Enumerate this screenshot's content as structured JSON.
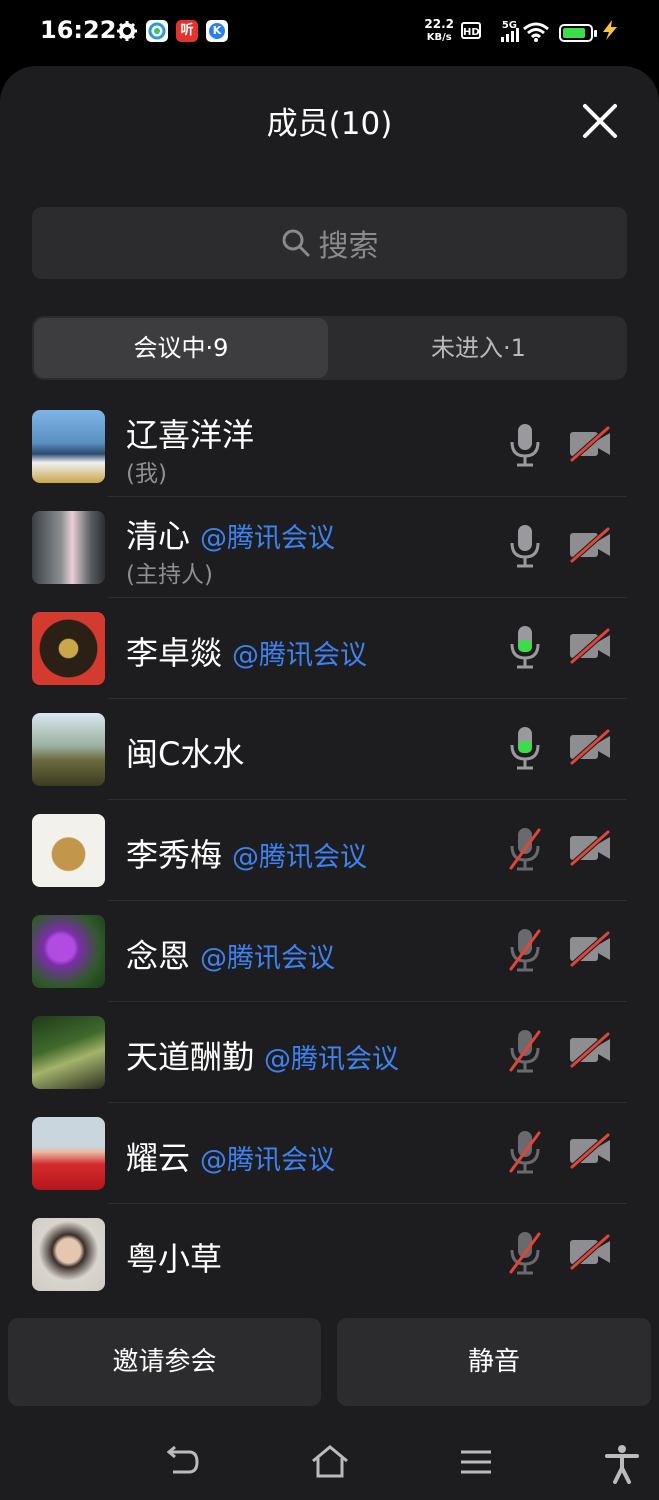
{
  "status_bar": {
    "time": "16:22",
    "speed_value": "22.2",
    "speed_unit": "KB/s",
    "hd": "HD",
    "network": "5G",
    "battery_level": 0.85,
    "app_icons": [
      "gear-icon",
      "browser-icon",
      "listen-app-icon",
      "k-app-icon"
    ],
    "listen_glyph": "听",
    "k_glyph": "K"
  },
  "sheet": {
    "title": "成员(10)",
    "search_placeholder": "搜索",
    "tabs": [
      {
        "label": "会议中·9",
        "active": true
      },
      {
        "label": "未进入·1",
        "active": false
      }
    ]
  },
  "members": [
    {
      "name": "辽喜洋洋",
      "tag": "",
      "role": "(我)",
      "mic": "on",
      "camera": "off"
    },
    {
      "name": "清心",
      "tag": "@腾讯会议",
      "role": "(主持人)",
      "mic": "on",
      "camera": "off"
    },
    {
      "name": "李卓燚",
      "tag": "@腾讯会议",
      "role": "",
      "mic": "speaking",
      "camera": "off"
    },
    {
      "name": "闽C水水",
      "tag": "",
      "role": "",
      "mic": "speaking",
      "camera": "off"
    },
    {
      "name": "李秀梅",
      "tag": "@腾讯会议",
      "role": "",
      "mic": "muted",
      "camera": "off"
    },
    {
      "name": "念恩",
      "tag": "@腾讯会议",
      "role": "",
      "mic": "muted",
      "camera": "off"
    },
    {
      "name": "天道酬勤",
      "tag": "@腾讯会议",
      "role": "",
      "mic": "muted",
      "camera": "off"
    },
    {
      "name": "耀云",
      "tag": "@腾讯会议",
      "role": "",
      "mic": "muted",
      "camera": "off"
    },
    {
      "name": "粤小草",
      "tag": "",
      "role": "",
      "mic": "muted",
      "camera": "off"
    }
  ],
  "footer": {
    "invite_label": "邀请参会",
    "mute_label": "静音"
  },
  "colors": {
    "accent_blue": "#3d82f0",
    "mic_green": "#3ddc4a",
    "muted_red": "#e0453a",
    "sheet_bg": "#1d1d1f"
  }
}
